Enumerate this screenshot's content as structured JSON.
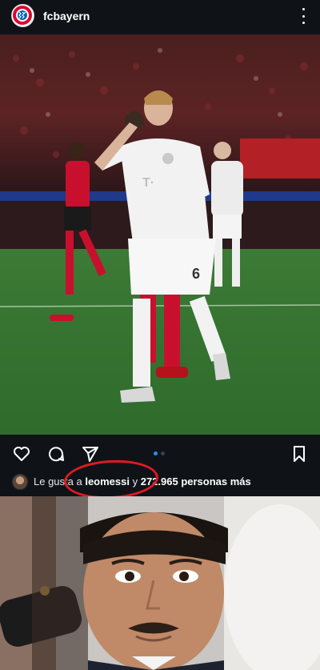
{
  "header": {
    "username": "fcbayern",
    "avatar_icon": "fc-bayern-crest-icon",
    "menu_icon": "more-vertical-icon"
  },
  "post": {
    "image_description_icon": "photo",
    "carousel": {
      "pages": 2,
      "current": 1
    }
  },
  "actions": {
    "like_icon": "heart-icon",
    "comment_icon": "comment-icon",
    "share_icon": "send-icon",
    "save_icon": "bookmark-icon"
  },
  "likes": {
    "prefix": "Le gusta a ",
    "user": "leomessi",
    "middle": " y ",
    "count": "272.965 personas más"
  },
  "colors": {
    "background": "#0f1318",
    "accent_blue": "#2b8cf2",
    "circle_red": "#e11a22"
  }
}
